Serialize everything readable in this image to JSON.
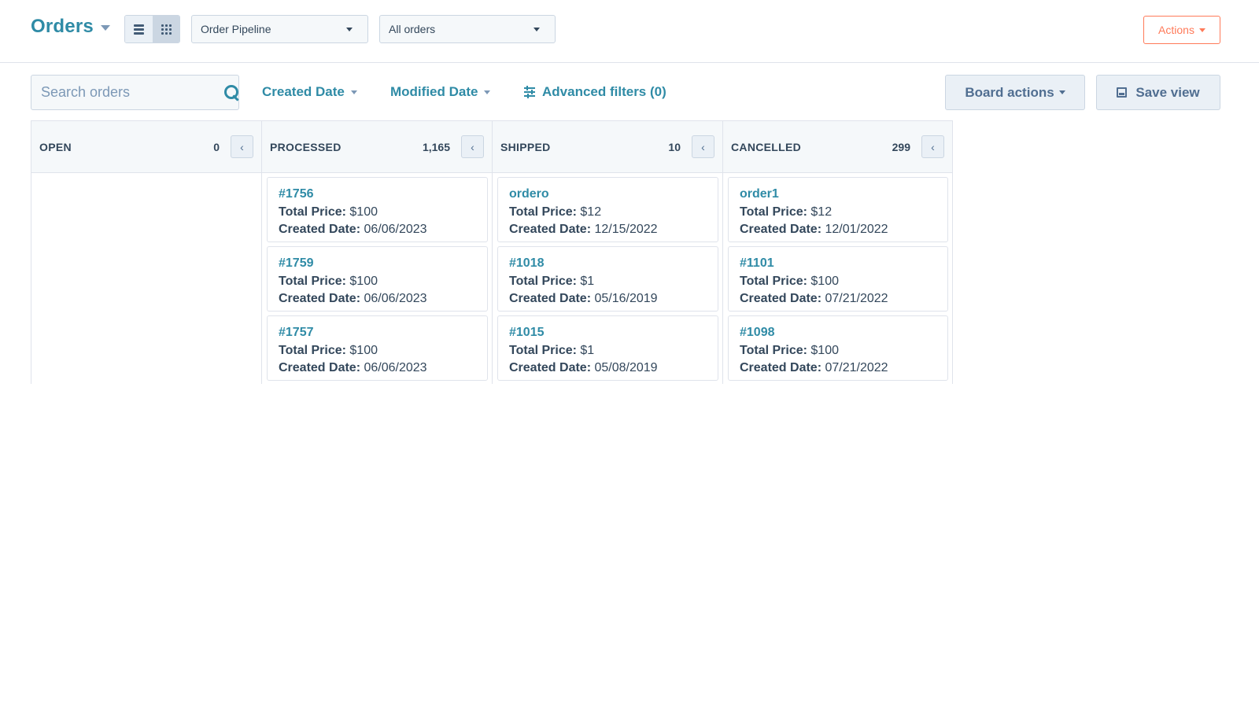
{
  "header": {
    "title": "Orders",
    "view_toggle": {
      "list_icon": "list-icon",
      "board_icon": "grid-icon",
      "active": "board"
    },
    "pipeline_select": {
      "value": "Order Pipeline"
    },
    "view_select": {
      "value": "All orders"
    },
    "actions_label": "Actions"
  },
  "filters": {
    "search_placeholder": "Search orders",
    "search_value": "",
    "created_date_label": "Created Date",
    "modified_date_label": "Modified Date",
    "advanced_filters_label": "Advanced filters (0)",
    "board_actions_label": "Board actions",
    "save_view_label": "Save view"
  },
  "labels": {
    "total_price": "Total Price:",
    "created_date": "Created Date:"
  },
  "colors": {
    "brand": "#2f8ba6",
    "actions_accent": "#ff7a59",
    "text": "#33475b"
  },
  "columns": [
    {
      "name": "OPEN",
      "count": "0",
      "cards": []
    },
    {
      "name": "PROCESSED",
      "count": "1,165",
      "cards": [
        {
          "title": "#1756",
          "total_price": "$100",
          "created_date": "06/06/2023"
        },
        {
          "title": "#1759",
          "total_price": "$100",
          "created_date": "06/06/2023"
        },
        {
          "title": "#1757",
          "total_price": "$100",
          "created_date": "06/06/2023"
        }
      ]
    },
    {
      "name": "SHIPPED",
      "count": "10",
      "cards": [
        {
          "title": "ordero",
          "total_price": "$12",
          "created_date": "12/15/2022"
        },
        {
          "title": "#1018",
          "total_price": "$1",
          "created_date": "05/16/2019"
        },
        {
          "title": "#1015",
          "total_price": "$1",
          "created_date": "05/08/2019"
        }
      ]
    },
    {
      "name": "CANCELLED",
      "count": "299",
      "cards": [
        {
          "title": "order1",
          "total_price": "$12",
          "created_date": "12/01/2022"
        },
        {
          "title": "#1101",
          "total_price": "$100",
          "created_date": "07/21/2022"
        },
        {
          "title": "#1098",
          "total_price": "$100",
          "created_date": "07/21/2022"
        }
      ]
    }
  ]
}
